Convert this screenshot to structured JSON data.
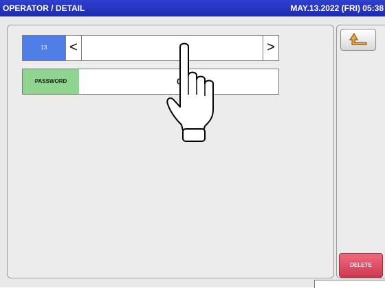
{
  "header": {
    "title": "OPERATOR / DETAIL",
    "datetime": "MAY.13.2022 (FRI) 05:38"
  },
  "operator_selector": {
    "number": "13",
    "prev_glyph": "<",
    "next_glyph": ">",
    "name_value": ""
  },
  "password_field": {
    "label": "PASSWORD",
    "value": "0"
  },
  "side": {
    "delete_label": "DELETE"
  },
  "icons": {
    "back": "return-arrow-icon",
    "pointer": "hand-pointer-icon"
  },
  "colors": {
    "titlebar": "#1e2bb0",
    "number_label": "#4f7fe6",
    "password_label": "#8fd48f",
    "delete_button": "#cf3a52"
  }
}
